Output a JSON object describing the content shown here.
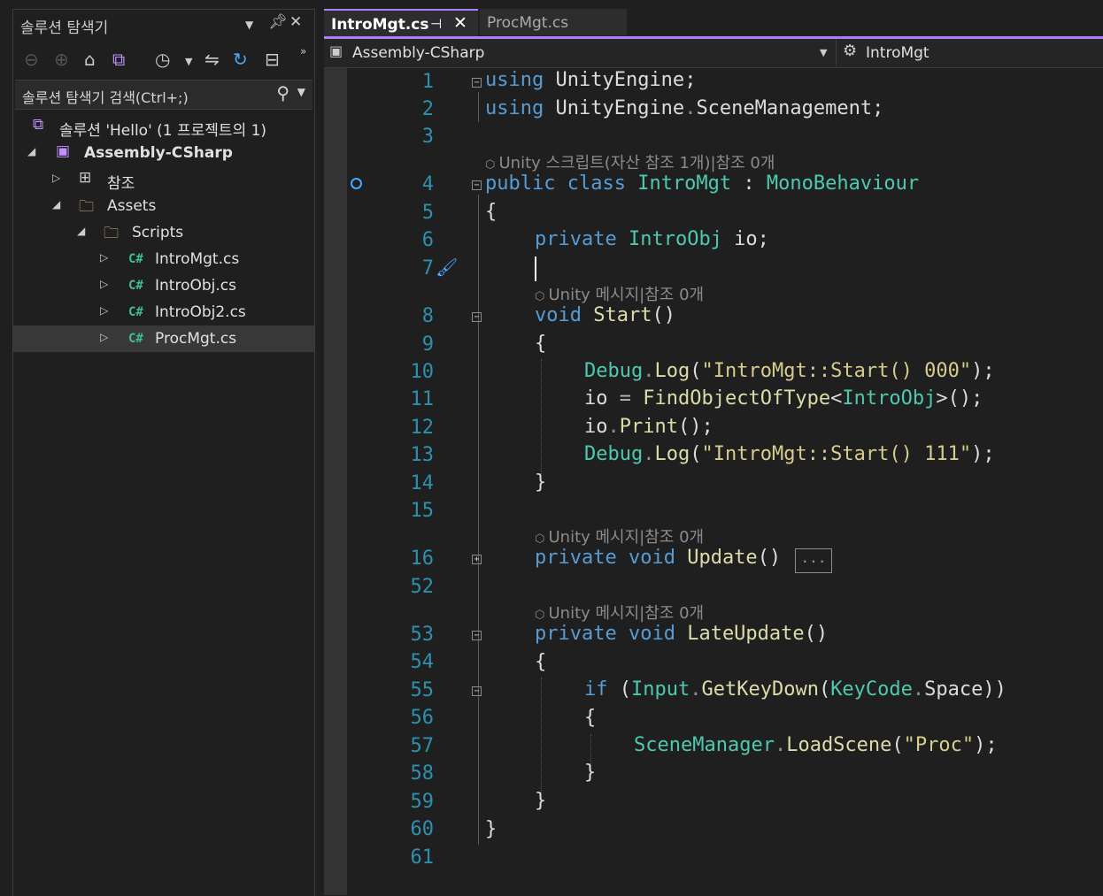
{
  "solution_explorer": {
    "title": "솔루션 탐색기",
    "search_placeholder": "솔루션 탐색기 검색(Ctrl+;)",
    "tree": [
      {
        "label": "솔루션 'Hello' (1 프로젝트의 1)",
        "icon": "solution-icon"
      },
      {
        "label": "Assembly-CSharp",
        "icon": "csharp-project-icon"
      },
      {
        "label": "참조",
        "icon": "references-icon"
      },
      {
        "label": "Assets",
        "icon": "folder-icon"
      },
      {
        "label": "Scripts",
        "icon": "folder-icon"
      },
      {
        "label": "IntroMgt.cs",
        "icon": "csharp-file-icon"
      },
      {
        "label": "IntroObj.cs",
        "icon": "csharp-file-icon"
      },
      {
        "label": "IntroObj2.cs",
        "icon": "csharp-file-icon"
      },
      {
        "label": "ProcMgt.cs",
        "icon": "csharp-file-icon",
        "selected": true
      }
    ],
    "cs_glyph": "C#"
  },
  "editor": {
    "tabs": [
      {
        "label": "IntroMgt.cs",
        "active": true
      },
      {
        "label": "ProcMgt.cs",
        "active": false
      }
    ],
    "nav_project": "Assembly-CSharp",
    "nav_class": "IntroMgt",
    "line_numbers": [
      "1",
      "2",
      "3",
      "4",
      "5",
      "6",
      "7",
      "8",
      "9",
      "10",
      "11",
      "12",
      "13",
      "14",
      "15",
      "16",
      "52",
      "53",
      "54",
      "55",
      "56",
      "57",
      "58",
      "59",
      "60",
      "61"
    ],
    "lens": {
      "class": "Unity 스크립트(자산 참조 1개)|참조 0개",
      "message": "Unity 메시지|참조 0개"
    },
    "collapsed_text": "..."
  },
  "colors": {
    "accent": "#a97fff",
    "keyword": "#569cd6",
    "type": "#4ec9b0",
    "string": "#d6cc8c",
    "method": "#dcdcaa",
    "line_number": "#2b91af"
  }
}
